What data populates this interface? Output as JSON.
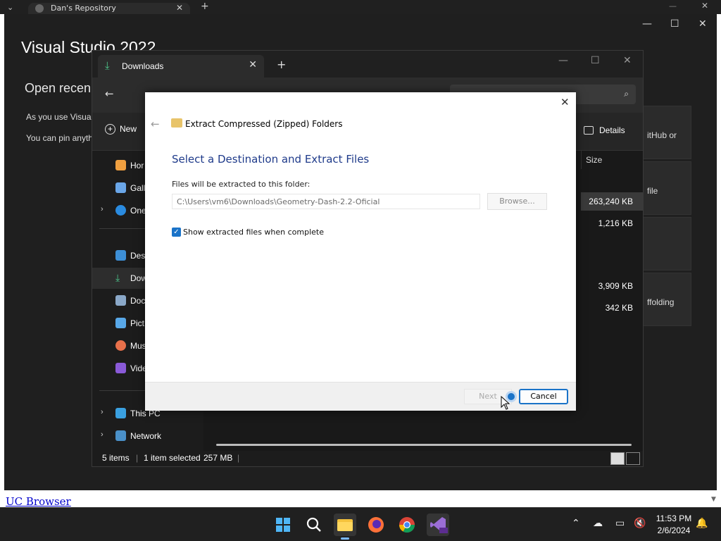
{
  "browser": {
    "tab_title": "Dan's Repository",
    "link_text": "UC Browser"
  },
  "vs": {
    "title": "Visual Studio 2022",
    "section": "Open recen",
    "line1": "As you use Visual",
    "line2": "You can pin anyth",
    "card1": "itHub or",
    "card2": "file",
    "card3": "ffolding"
  },
  "explorer": {
    "tab_title": "Downloads",
    "new_label": "New",
    "details_label": "Details",
    "nav": [
      {
        "label": "Hor"
      },
      {
        "label": "Gall"
      },
      {
        "label": "One"
      },
      {
        "label": "Desi"
      },
      {
        "label": "Dow"
      },
      {
        "label": "Doc"
      },
      {
        "label": "Pict"
      },
      {
        "label": "Mus"
      },
      {
        "label": "Vide"
      },
      {
        "label": "This PC"
      },
      {
        "label": "Network"
      }
    ],
    "col_size": "Size",
    "sizes": [
      "263,240 KB",
      "1,216 KB",
      "3,909 KB",
      "342 KB"
    ],
    "status": {
      "items": "5 items",
      "selected": "1 item selected",
      "size": "257 MB"
    }
  },
  "dialog": {
    "title": "Extract Compressed (Zipped) Folders",
    "heading": "Select a Destination and Extract Files",
    "folder_label": "Files will be extracted to this folder:",
    "path_value": "C:\\Users\\vm6\\Downloads\\Geometry-Dash-2.2-Oficial",
    "browse_label": "Browse...",
    "checkbox_label": "Show extracted files when complete",
    "next_label": "Next",
    "cancel_label": "Cancel"
  },
  "taskbar": {
    "time": "11:53 PM",
    "date": "2/6/2024"
  },
  "colors": {
    "accent": "#1a73c8",
    "dialog_heading": "#1e3a8a",
    "explorer_download_icon": "#4cc38a"
  },
  "icons": [
    "search-icon",
    "folder-icon",
    "firefox-icon",
    "chrome-icon",
    "visual-studio-icon",
    "notification-bell-icon"
  ]
}
